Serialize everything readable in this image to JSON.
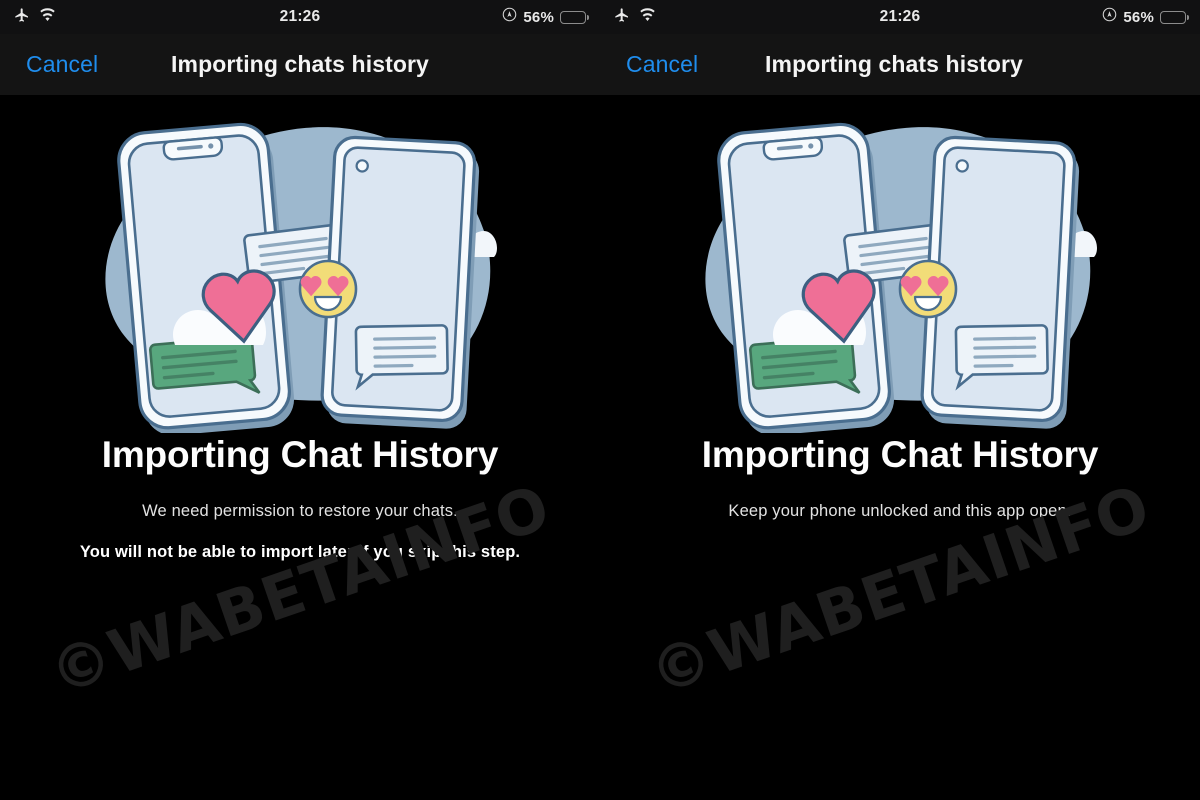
{
  "meta": {
    "watermark": "©WABETAINFO",
    "background_color": "#000000",
    "navbar_color": "#141414",
    "accent_blue": "#1f8ded",
    "battery_color": "#f5cb2a",
    "blob_color": "#9db8ce",
    "heart_color": "#ef6f96",
    "emoji_color": "#f2dc78",
    "green_bubble_color": "#58a77e",
    "phone_screen_color": "#dbe6f2"
  },
  "status_bar": {
    "airplane_icon": "airplane-icon",
    "wifi_icon": "wifi-icon",
    "time": "21:26",
    "location_icon": "location-arrow-icon",
    "battery_percent": "56%",
    "battery_level": 56,
    "battery_low_power": true
  },
  "nav_bar": {
    "cancel_label": "Cancel",
    "title": "Importing chats history"
  },
  "panels": [
    {
      "id": "permission-screen",
      "headline": "Importing Chat History",
      "subline": "We need permission to restore your chats.",
      "warnline": "You will not be able to import later if you skip this step.",
      "illustration": "two-phones-transfer-illustration"
    },
    {
      "id": "progress-screen",
      "headline": "Importing Chat History",
      "subline": "Keep your phone unlocked and this app open.",
      "warnline": "",
      "illustration": "two-phones-transfer-illustration"
    }
  ]
}
